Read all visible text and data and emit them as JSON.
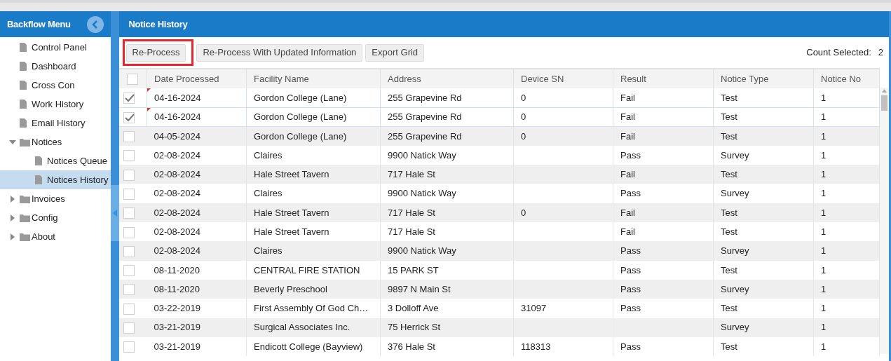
{
  "sidebar": {
    "title": "Backflow Menu",
    "items": [
      {
        "label": "Control Panel",
        "kind": "page",
        "selected": false
      },
      {
        "label": "Dashboard",
        "kind": "page",
        "selected": false
      },
      {
        "label": "Cross Con",
        "kind": "page",
        "selected": false
      },
      {
        "label": "Work History",
        "kind": "page",
        "selected": false
      },
      {
        "label": "Email History",
        "kind": "page",
        "selected": false
      },
      {
        "label": "Notices",
        "kind": "folder",
        "expanded": true,
        "selected": false,
        "children": [
          {
            "label": "Notices Queue",
            "kind": "page",
            "selected": false
          },
          {
            "label": "Notices History",
            "kind": "page",
            "selected": true
          }
        ]
      },
      {
        "label": "Invoices",
        "kind": "folder",
        "expanded": false,
        "selected": false
      },
      {
        "label": "Config",
        "kind": "folder",
        "expanded": false,
        "selected": false
      },
      {
        "label": "About",
        "kind": "folder",
        "expanded": false,
        "selected": false
      }
    ]
  },
  "main": {
    "title": "Notice History"
  },
  "toolbar": {
    "buttons": [
      {
        "label": "Re-Process",
        "highlighted": true
      },
      {
        "label": "Re-Process With Updated Information",
        "highlighted": false
      },
      {
        "label": "Export Grid",
        "highlighted": false
      }
    ],
    "count_label": "Count Selected:",
    "count_value": "2"
  },
  "table": {
    "columns": [
      "Date Processed",
      "Facility Name",
      "Address",
      "Device SN",
      "Result",
      "Notice Type",
      "Notice No"
    ],
    "header_checked": false,
    "rows": [
      {
        "checked": true,
        "edited": true,
        "cells": [
          "04-16-2024",
          "Gordon College (Lane)",
          "255 Grapevine Rd",
          "0",
          "Fail",
          "Test",
          "1"
        ]
      },
      {
        "checked": true,
        "edited": true,
        "cells": [
          "04-16-2024",
          "Gordon College (Lane)",
          "255 Grapevine Rd",
          "0",
          "Fail",
          "Test",
          "1"
        ]
      },
      {
        "checked": false,
        "edited": false,
        "cells": [
          "04-05-2024",
          "Gordon College (Lane)",
          "255 Grapevine Rd",
          "0",
          "Fail",
          "Test",
          "1"
        ]
      },
      {
        "checked": false,
        "edited": false,
        "cells": [
          "02-08-2024",
          "Claires",
          "9900 Natick Way",
          "",
          "Pass",
          "Survey",
          "1"
        ]
      },
      {
        "checked": false,
        "edited": false,
        "cells": [
          "02-08-2024",
          "Hale Street Tavern",
          "717 Hale St",
          "",
          "Fail",
          "Test",
          "1"
        ]
      },
      {
        "checked": false,
        "edited": false,
        "cells": [
          "02-08-2024",
          "Claires",
          "9900 Natick Way",
          "",
          "Pass",
          "Survey",
          "1"
        ]
      },
      {
        "checked": false,
        "edited": false,
        "cells": [
          "02-08-2024",
          "Hale Street Tavern",
          "717 Hale St",
          "0",
          "Fail",
          "Test",
          "1"
        ]
      },
      {
        "checked": false,
        "edited": false,
        "cells": [
          "02-08-2024",
          "Hale Street Tavern",
          "717 Hale St",
          "",
          "Fail",
          "Test",
          "1"
        ]
      },
      {
        "checked": false,
        "edited": false,
        "cells": [
          "02-08-2024",
          "Claires",
          "9900 Natick Way",
          "",
          "Pass",
          "Survey",
          "1"
        ]
      },
      {
        "checked": false,
        "edited": false,
        "cells": [
          "08-11-2020",
          "CENTRAL FIRE STATION",
          "15 PARK ST",
          "",
          "Pass",
          "Test",
          "1"
        ]
      },
      {
        "checked": false,
        "edited": false,
        "cells": [
          "08-11-2020",
          "Beverly Preschool",
          "9897 N Main St",
          "",
          "Pass",
          "Survey",
          "1"
        ]
      },
      {
        "checked": false,
        "edited": false,
        "cells": [
          "03-22-2019",
          "First Assembly Of God Ch…",
          "3 Dolloff Ave",
          "31097",
          "Pass",
          "Test",
          "1"
        ]
      },
      {
        "checked": false,
        "edited": false,
        "cells": [
          "03-21-2019",
          "Surgical Associates Inc.",
          "75 Herrick St",
          "",
          "",
          "Survey",
          "1"
        ]
      },
      {
        "checked": false,
        "edited": false,
        "cells": [
          "03-21-2019",
          "Endicott College (Bayview)",
          "376 Hale St",
          "118313",
          "Pass",
          "Test",
          "1"
        ]
      }
    ]
  }
}
